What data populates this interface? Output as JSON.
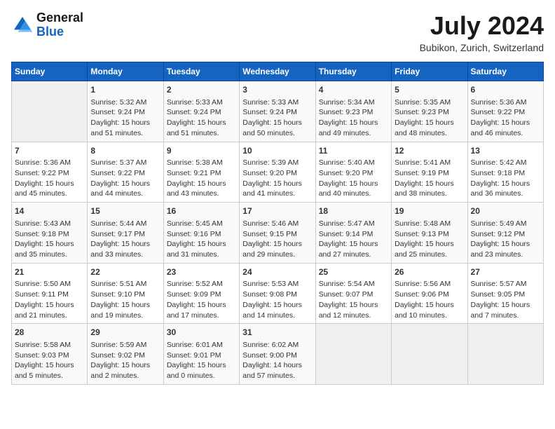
{
  "header": {
    "logo_general": "General",
    "logo_blue": "Blue",
    "title": "July 2024",
    "location": "Bubikon, Zurich, Switzerland"
  },
  "calendar": {
    "days_of_week": [
      "Sunday",
      "Monday",
      "Tuesday",
      "Wednesday",
      "Thursday",
      "Friday",
      "Saturday"
    ],
    "weeks": [
      [
        {
          "day": "",
          "info": ""
        },
        {
          "day": "1",
          "info": "Sunrise: 5:32 AM\nSunset: 9:24 PM\nDaylight: 15 hours\nand 51 minutes."
        },
        {
          "day": "2",
          "info": "Sunrise: 5:33 AM\nSunset: 9:24 PM\nDaylight: 15 hours\nand 51 minutes."
        },
        {
          "day": "3",
          "info": "Sunrise: 5:33 AM\nSunset: 9:24 PM\nDaylight: 15 hours\nand 50 minutes."
        },
        {
          "day": "4",
          "info": "Sunrise: 5:34 AM\nSunset: 9:23 PM\nDaylight: 15 hours\nand 49 minutes."
        },
        {
          "day": "5",
          "info": "Sunrise: 5:35 AM\nSunset: 9:23 PM\nDaylight: 15 hours\nand 48 minutes."
        },
        {
          "day": "6",
          "info": "Sunrise: 5:36 AM\nSunset: 9:22 PM\nDaylight: 15 hours\nand 46 minutes."
        }
      ],
      [
        {
          "day": "7",
          "info": "Sunrise: 5:36 AM\nSunset: 9:22 PM\nDaylight: 15 hours\nand 45 minutes."
        },
        {
          "day": "8",
          "info": "Sunrise: 5:37 AM\nSunset: 9:22 PM\nDaylight: 15 hours\nand 44 minutes."
        },
        {
          "day": "9",
          "info": "Sunrise: 5:38 AM\nSunset: 9:21 PM\nDaylight: 15 hours\nand 43 minutes."
        },
        {
          "day": "10",
          "info": "Sunrise: 5:39 AM\nSunset: 9:20 PM\nDaylight: 15 hours\nand 41 minutes."
        },
        {
          "day": "11",
          "info": "Sunrise: 5:40 AM\nSunset: 9:20 PM\nDaylight: 15 hours\nand 40 minutes."
        },
        {
          "day": "12",
          "info": "Sunrise: 5:41 AM\nSunset: 9:19 PM\nDaylight: 15 hours\nand 38 minutes."
        },
        {
          "day": "13",
          "info": "Sunrise: 5:42 AM\nSunset: 9:18 PM\nDaylight: 15 hours\nand 36 minutes."
        }
      ],
      [
        {
          "day": "14",
          "info": "Sunrise: 5:43 AM\nSunset: 9:18 PM\nDaylight: 15 hours\nand 35 minutes."
        },
        {
          "day": "15",
          "info": "Sunrise: 5:44 AM\nSunset: 9:17 PM\nDaylight: 15 hours\nand 33 minutes."
        },
        {
          "day": "16",
          "info": "Sunrise: 5:45 AM\nSunset: 9:16 PM\nDaylight: 15 hours\nand 31 minutes."
        },
        {
          "day": "17",
          "info": "Sunrise: 5:46 AM\nSunset: 9:15 PM\nDaylight: 15 hours\nand 29 minutes."
        },
        {
          "day": "18",
          "info": "Sunrise: 5:47 AM\nSunset: 9:14 PM\nDaylight: 15 hours\nand 27 minutes."
        },
        {
          "day": "19",
          "info": "Sunrise: 5:48 AM\nSunset: 9:13 PM\nDaylight: 15 hours\nand 25 minutes."
        },
        {
          "day": "20",
          "info": "Sunrise: 5:49 AM\nSunset: 9:12 PM\nDaylight: 15 hours\nand 23 minutes."
        }
      ],
      [
        {
          "day": "21",
          "info": "Sunrise: 5:50 AM\nSunset: 9:11 PM\nDaylight: 15 hours\nand 21 minutes."
        },
        {
          "day": "22",
          "info": "Sunrise: 5:51 AM\nSunset: 9:10 PM\nDaylight: 15 hours\nand 19 minutes."
        },
        {
          "day": "23",
          "info": "Sunrise: 5:52 AM\nSunset: 9:09 PM\nDaylight: 15 hours\nand 17 minutes."
        },
        {
          "day": "24",
          "info": "Sunrise: 5:53 AM\nSunset: 9:08 PM\nDaylight: 15 hours\nand 14 minutes."
        },
        {
          "day": "25",
          "info": "Sunrise: 5:54 AM\nSunset: 9:07 PM\nDaylight: 15 hours\nand 12 minutes."
        },
        {
          "day": "26",
          "info": "Sunrise: 5:56 AM\nSunset: 9:06 PM\nDaylight: 15 hours\nand 10 minutes."
        },
        {
          "day": "27",
          "info": "Sunrise: 5:57 AM\nSunset: 9:05 PM\nDaylight: 15 hours\nand 7 minutes."
        }
      ],
      [
        {
          "day": "28",
          "info": "Sunrise: 5:58 AM\nSunset: 9:03 PM\nDaylight: 15 hours\nand 5 minutes."
        },
        {
          "day": "29",
          "info": "Sunrise: 5:59 AM\nSunset: 9:02 PM\nDaylight: 15 hours\nand 2 minutes."
        },
        {
          "day": "30",
          "info": "Sunrise: 6:01 AM\nSunset: 9:01 PM\nDaylight: 15 hours\nand 0 minutes."
        },
        {
          "day": "31",
          "info": "Sunrise: 6:02 AM\nSunset: 9:00 PM\nDaylight: 14 hours\nand 57 minutes."
        },
        {
          "day": "",
          "info": ""
        },
        {
          "day": "",
          "info": ""
        },
        {
          "day": "",
          "info": ""
        }
      ]
    ]
  }
}
